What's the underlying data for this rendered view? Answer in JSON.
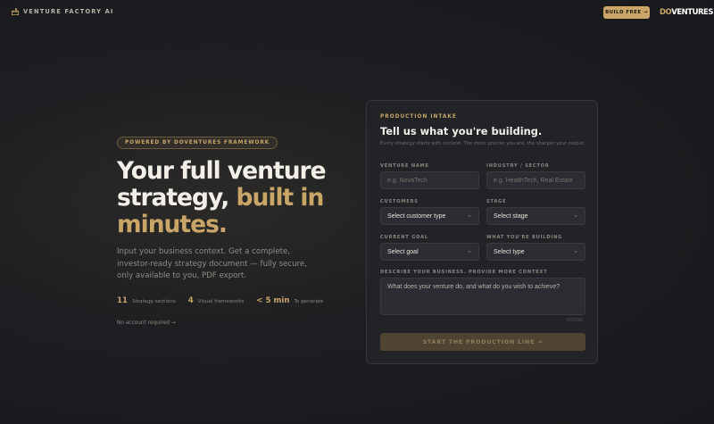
{
  "nav": {
    "brand": "VENTURE FACTORY AI",
    "build_button": "BUILD FREE →",
    "logo_do": "DO",
    "logo_rest": "VENTURES"
  },
  "hero": {
    "badge": "POWERED BY DOVENTURES FRAMEWORK",
    "headline_white": "Your full venture strategy,",
    "headline_gold": "built in minutes.",
    "subtext": "Input your business context. Get a complete, investor-ready strategy document — fully secure, only available to you, PDF export.",
    "stats": [
      {
        "num": "11",
        "label": "Strategy sections"
      },
      {
        "num": "4",
        "label": "Visual frameworks"
      },
      {
        "num": "< 5 min",
        "label": "To generate"
      }
    ],
    "no_account": "No account required →"
  },
  "form": {
    "kicker": "PRODUCTION INTAKE",
    "title": "Tell us what you're building.",
    "subtitle": "Every strategy starts with context. The more precise you are, the sharper your output.",
    "venture_name": {
      "label": "VENTURE NAME",
      "placeholder": "e.g. NovaTech",
      "value": ""
    },
    "industry": {
      "label": "INDUSTRY / SECTOR",
      "placeholder": "e.g. HealthTech, Real Estate",
      "value": ""
    },
    "customers": {
      "label": "CUSTOMERS",
      "selected": "Select customer type"
    },
    "stage": {
      "label": "STAGE",
      "selected": "Select stage"
    },
    "goal": {
      "label": "CURRENT GOAL",
      "selected": "Select goal"
    },
    "building": {
      "label": "WHAT YOU'RE BUILDING",
      "selected": "Select type"
    },
    "describe": {
      "label": "DESCRIBE YOUR BUSINESS. PROVIDE MORE CONTEXT",
      "placeholder": "What does your venture do, and what do you wish to achieve?",
      "value": ""
    },
    "counter": "0/2000",
    "submit": "START THE PRODUCTION LINE →"
  },
  "colors": {
    "accent": "#c9a567",
    "background": "#1d1e21",
    "card": "#222327"
  },
  "icons": {
    "brand": "factory-icon",
    "select": "chevron-down-icon"
  }
}
